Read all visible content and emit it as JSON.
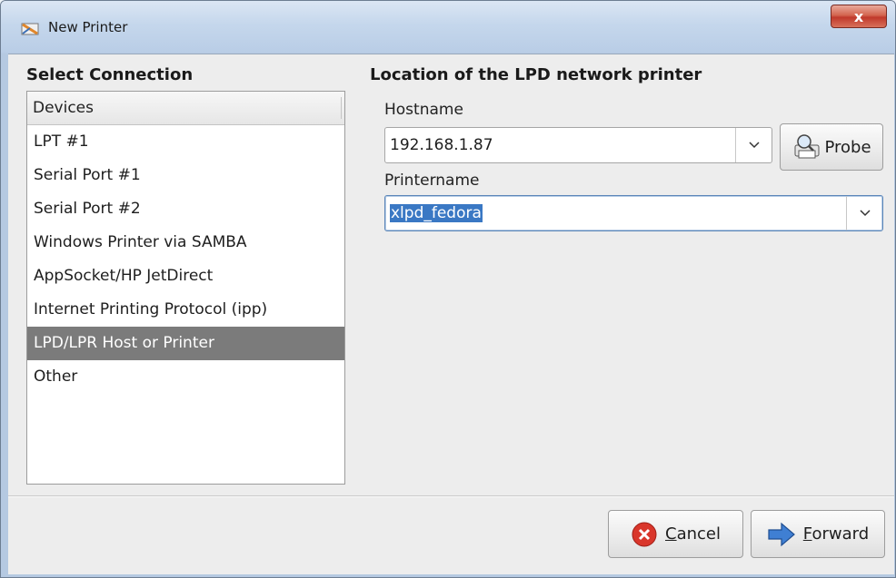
{
  "window": {
    "title": "New Printer",
    "close_label": "x"
  },
  "left_panel": {
    "title": "Select Connection",
    "list_header": "Devices",
    "items": [
      {
        "label": "LPT #1",
        "selected": false
      },
      {
        "label": "Serial Port #1",
        "selected": false
      },
      {
        "label": "Serial Port #2",
        "selected": false
      },
      {
        "label": "Windows Printer via SAMBA",
        "selected": false
      },
      {
        "label": "AppSocket/HP JetDirect",
        "selected": false
      },
      {
        "label": "Internet Printing Protocol (ipp)",
        "selected": false
      },
      {
        "label": "LPD/LPR Host or Printer",
        "selected": true
      },
      {
        "label": "Other",
        "selected": false
      }
    ]
  },
  "right_panel": {
    "title": "Location of the LPD network printer",
    "hostname_label": "Hostname",
    "hostname_value": "192.168.1.87",
    "probe_label": "Probe",
    "printername_label": "Printername",
    "printername_value": "xlpd_fedora"
  },
  "buttons": {
    "cancel_mnemonic": "C",
    "cancel_rest": "ancel",
    "forward_mnemonic": "F",
    "forward_rest": "orward"
  },
  "icons": {
    "window": "printer-app-icon",
    "probe": "printer-search-icon",
    "cancel": "cancel-icon",
    "forward": "forward-arrow-icon",
    "dropdown": "chevron-down-icon"
  },
  "colors": {
    "selection": "#7b7b7b",
    "text_selection": "#3a78c4",
    "close_button": "#c0392b"
  }
}
